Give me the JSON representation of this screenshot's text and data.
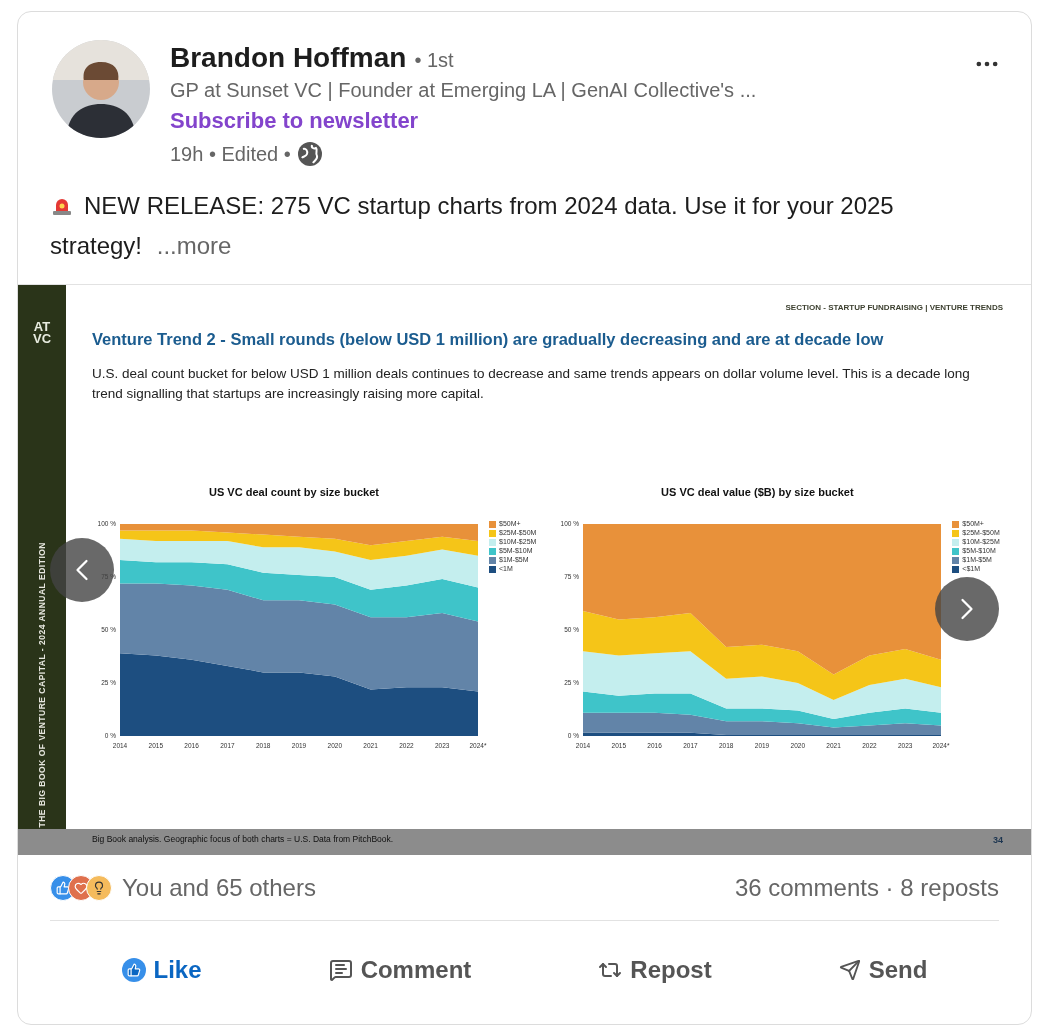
{
  "post": {
    "author": {
      "name": "Brandon Hoffman",
      "degree": "• 1st",
      "headline": "GP at Sunset VC | Founder at Emerging LA | GenAI Collective's ...",
      "subscribe": "Subscribe to newsletter",
      "time": "19h • Edited •"
    },
    "text": "NEW RELEASE: 275 VC startup charts from 2024 data. Use it for your 2025 strategy!",
    "more": "...more"
  },
  "document": {
    "logo": [
      "AT",
      "VC"
    ],
    "edition": "THE BIG BOOK OF VENTURE CAPITAL - 2024 ANNUAL EDITION",
    "section": "SECTION - STARTUP FUNDRAISING | VENTURE TRENDS",
    "title": "Venture Trend 2 - Small rounds (below USD 1 million) are gradually decreasing and are at decade low",
    "description": "U.S. deal count bucket for below USD 1 million deals continues to decrease and same trends appears on dollar volume level. This is a decade long trend signalling that startups are increasingly raising more capital.",
    "charts": [
      {
        "chart_data": {
          "type": "area",
          "title": "US VC deal count by size bucket",
          "stacked": true,
          "legend": "right",
          "categories": [
            "2014",
            "2015",
            "2016",
            "2017",
            "2018",
            "2019",
            "2020",
            "2021",
            "2022",
            "2023",
            "2024*"
          ],
          "ylim": [
            0,
            100
          ],
          "yticks": [
            {
              "value": 0,
              "label": "0 %"
            },
            {
              "value": 25,
              "label": "25 %"
            },
            {
              "value": 50,
              "label": "50 %"
            },
            {
              "value": 75,
              "label": "75 %"
            },
            {
              "value": 100,
              "label": "100 %"
            }
          ],
          "series": [
            {
              "name": "<1M",
              "color": "#1d4e80",
              "values": [
                39,
                38,
                36,
                33,
                30,
                30,
                28,
                22,
                23,
                23,
                21
              ]
            },
            {
              "name": "$1M-$5M",
              "color": "#6284a8",
              "values": [
                33,
                34,
                35,
                36,
                34,
                34,
                34,
                34,
                33,
                35,
                33
              ]
            },
            {
              "name": "$5M-$10M",
              "color": "#3fc4c9",
              "values": [
                11,
                10,
                11,
                12,
                13,
                12,
                13,
                13,
                15,
                16,
                16
              ]
            },
            {
              "name": "$10M-$25M",
              "color": "#c4eeee",
              "values": [
                10,
                10,
                10,
                11,
                12,
                13,
                12,
                14,
                14,
                14,
                15
              ]
            },
            {
              "name": "$25M-$50M",
              "color": "#f5c518",
              "values": [
                4,
                5,
                5,
                4,
                6,
                5,
                6,
                7,
                7,
                6,
                7
              ]
            },
            {
              "name": "$50M+",
              "color": "#e8913a",
              "values": [
                3,
                3,
                3,
                4,
                5,
                6,
                7,
                10,
                8,
                6,
                8
              ]
            }
          ]
        }
      },
      {
        "chart_data": {
          "type": "area",
          "title": "US VC deal value ($B) by size bucket",
          "stacked": true,
          "legend": "right",
          "categories": [
            "2014",
            "2015",
            "2016",
            "2017",
            "2018",
            "2019",
            "2020",
            "2021",
            "2022",
            "2023",
            "2024*"
          ],
          "ylim": [
            0,
            100
          ],
          "yticks": [
            {
              "value": 0,
              "label": "0 %"
            },
            {
              "value": 25,
              "label": "25 %"
            },
            {
              "value": 50,
              "label": "50 %"
            },
            {
              "value": 75,
              "label": "75 %"
            },
            {
              "value": 100,
              "label": "100 %"
            }
          ],
          "series": [
            {
              "name": "<$1M",
              "color": "#1d4e80",
              "values": [
                1.5,
                1.5,
                1.5,
                1.5,
                0.5,
                0.5,
                0.5,
                0.5,
                0.5,
                0.5,
                0.5
              ]
            },
            {
              "name": "$1M-$5M",
              "color": "#6284a8",
              "values": [
                9.5,
                9.5,
                9.5,
                8.5,
                6.5,
                6.5,
                5.5,
                3.5,
                4.5,
                5.5,
                4.5
              ]
            },
            {
              "name": "$5M-$10M",
              "color": "#3fc4c9",
              "values": [
                10,
                8,
                9,
                10,
                6,
                6,
                6,
                4,
                6,
                7,
                6
              ]
            },
            {
              "name": "$10M-$25M",
              "color": "#c4eeee",
              "values": [
                19,
                19,
                19,
                20,
                14,
                15,
                13,
                9,
                13,
                14,
                12
              ]
            },
            {
              "name": "$25M-$50M",
              "color": "#f5c518",
              "values": [
                19,
                17,
                17,
                18,
                15,
                15,
                15,
                12,
                14,
                14,
                13
              ]
            },
            {
              "name": "$50M+",
              "color": "#e8913a",
              "values": [
                41,
                45,
                44,
                42,
                58,
                57,
                60,
                71,
                62,
                59,
                64
              ]
            }
          ]
        }
      }
    ],
    "footnote": "Big Book analysis. Geographic focus of both charts = U.S. Data from PitchBook.",
    "page_number": "34"
  },
  "social": {
    "reactions": "You and 65 others",
    "counts": "36 comments · 8 reposts"
  },
  "actions": [
    {
      "label": "Like",
      "kind": "like",
      "active": true
    },
    {
      "label": "Comment",
      "kind": "comment",
      "active": false
    },
    {
      "label": "Repost",
      "kind": "repost",
      "active": false
    },
    {
      "label": "Send",
      "kind": "send",
      "active": false
    }
  ]
}
